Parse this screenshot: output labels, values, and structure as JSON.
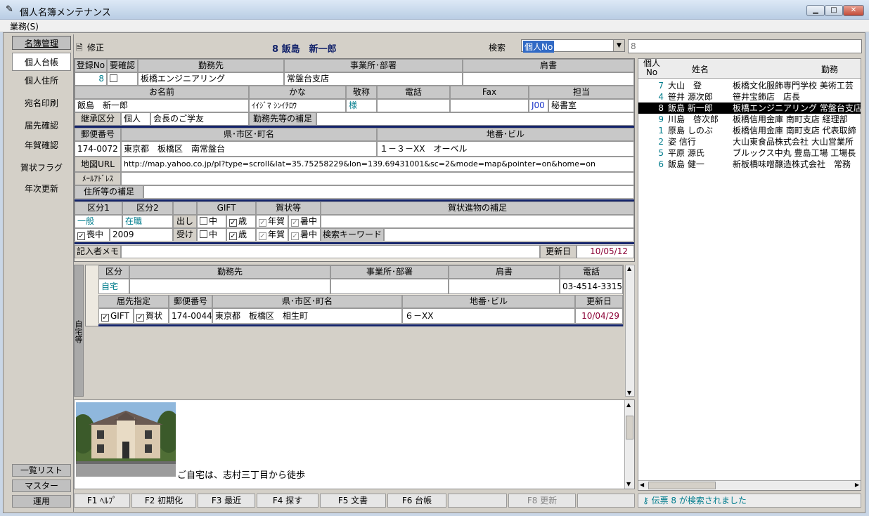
{
  "window": {
    "title": "個人名簿メンテナンス",
    "menu": "業務(S)"
  },
  "sidebar": {
    "top_label": "名簿管理",
    "items": [
      "個人台帳",
      "個人住所",
      "宛名印刷",
      "届先確認",
      "年賀確認",
      "賀状フラグ",
      "年次更新"
    ],
    "bottom": [
      "一覧リスト",
      "マスター",
      "運用"
    ]
  },
  "header": {
    "mode_label": "修正",
    "record_title": "8 飯島　新一郎",
    "search_label": "検索",
    "search_type": "個人No",
    "search_value": "8"
  },
  "record": {
    "h_reg_no": "登録No",
    "h_confirm": "要確認",
    "h_company": "勤務先",
    "h_office": "事業所･部署",
    "h_position": "肩書",
    "reg_no": "8",
    "company": "板橋エンジニアリング",
    "office": "常盤台支店",
    "position": "",
    "h_name": "お名前",
    "h_kana": "かな",
    "h_honorific": "敬称",
    "h_phone": "電話",
    "h_fax": "Fax",
    "h_staff": "担当",
    "name": "飯島　新一郎",
    "kana": "ｲｲｼﾞﾏ ｼﾝｲﾁﾛｳ",
    "honorific": "様",
    "phone": "",
    "fax": "",
    "staff_code": "J00",
    "staff_name": "秘書室",
    "h_inherit": "継承区分",
    "inherit1": "個人",
    "inherit2": "会長のご学友",
    "h_work_supp": "勤務先等の補足",
    "h_zip": "郵便番号",
    "h_pref": "県･市区･町名",
    "h_addr": "地番･ビル",
    "zip": "174-0072",
    "pref": "東京都　板橋区　南常盤台",
    "addr": "１－３－XX　オーベル",
    "h_map": "地図URL",
    "map": "http://map.yahoo.co.jp/pl?type=scroll&lat=35.75258229&lon=139.69431001&sc=2&mode=map&pointer=on&home=on",
    "h_mail": "ﾒｰﾙｱﾄﾞﾚｽ",
    "mail": "",
    "h_addr_supp": "住所等の補足",
    "h_cat1": "区分1",
    "h_cat2": "区分2",
    "h_gift": "GIFT",
    "h_greet": "賀状等",
    "h_greet_supp": "賀状進物の補足",
    "cat1": "一般",
    "cat2": "在職",
    "send_label": "出し",
    "recv_label": "受け",
    "chk_chu": "中",
    "chk_sai": "歳",
    "chk_nenga": "年賀",
    "chk_shochu": "暑中",
    "mourning_label": "喪中",
    "mourning_year": "2009",
    "keyword_label": "検索キーワード",
    "h_memo": "記入者メモ",
    "h_updated": "更新日",
    "updated": "10/05/12"
  },
  "home": {
    "side_label": "自宅等",
    "h_cat": "区分",
    "h_company": "勤務先",
    "h_office": "事業所･部署",
    "h_position": "肩書",
    "h_phone": "電話",
    "cat": "自宅",
    "phone": "03-4514-3315",
    "h_dest": "届先指定",
    "h_zip": "郵便番号",
    "h_pref": "県･市区･町名",
    "h_addr": "地番･ビル",
    "h_updated": "更新日",
    "dest_gift": "GIFT",
    "dest_card": "賀状",
    "zip": "174-0044",
    "pref": "東京都　板橋区　相生町",
    "addr": "６－XX",
    "updated": "10/04/29"
  },
  "notes": {
    "caption": "ご自宅は、志村三丁目から徒歩"
  },
  "list": {
    "h_no": "個人No",
    "h_name": "姓名",
    "h_work": "勤務",
    "rows": [
      {
        "no": "7",
        "name": "大山　登",
        "work": "板橋文化服飾専門学校 美術工芸"
      },
      {
        "no": "4",
        "name": "笹井 源次郎",
        "work": "笹井宝飾店　店長"
      },
      {
        "no": "8",
        "name": "飯島 新一郎",
        "work": "板橋エンジニアリング 常盤台支店"
      },
      {
        "no": "9",
        "name": "川島　啓次郎",
        "work": "板橋信用金庫 南町支店 経理部"
      },
      {
        "no": "1",
        "name": "原島 しのぶ",
        "work": "板橋信用金庫 南町支店 代表取締"
      },
      {
        "no": "2",
        "name": "姿 信行",
        "work": "大山東食品株式会社 大山営業所"
      },
      {
        "no": "5",
        "name": "平原 源氏",
        "work": "ブルックス中丸 豊島工場 工場長"
      },
      {
        "no": "6",
        "name": "飯島 健一",
        "work": "新板橋味噌醸造株式会社　常務"
      }
    ]
  },
  "fkeys": [
    "F1 ﾍﾙﾌﾟ",
    "F2 初期化",
    "F3 最近",
    "F4 探す",
    "F5 文書",
    "F6 台帳",
    "F8 更新"
  ],
  "status": "伝票 8 が検索されました",
  "colors": {
    "accent_teal": "#007c8c",
    "accent_navy": "#14246b",
    "selected_row": "#000000",
    "date_maroon": "#8b0035"
  }
}
